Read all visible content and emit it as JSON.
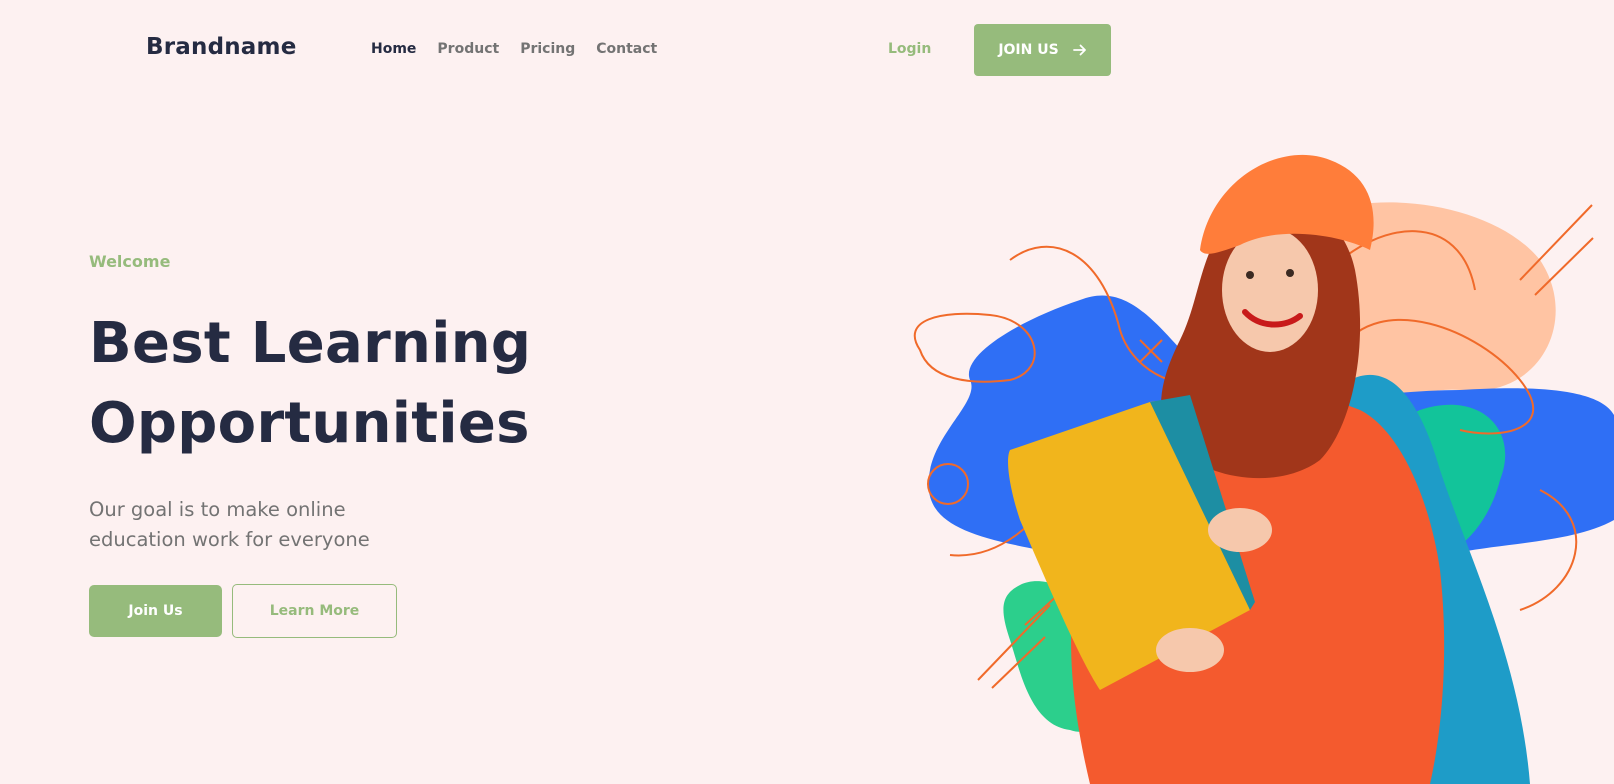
{
  "header": {
    "brand": "Brandname",
    "nav": [
      {
        "label": "Home",
        "active": true
      },
      {
        "label": "Product",
        "active": false
      },
      {
        "label": "Pricing",
        "active": false
      },
      {
        "label": "Contact",
        "active": false
      }
    ],
    "login_label": "Login",
    "join_label": "JOIN US",
    "join_icon": "arrow-right-icon"
  },
  "hero": {
    "eyebrow": "Welcome",
    "title_line1": "Best Learning",
    "title_line2": "Opportunities",
    "subtitle_line1": "Our goal is to make online",
    "subtitle_line2": "education work for everyone",
    "primary_button": "Join Us",
    "secondary_button": "Learn More"
  },
  "colors": {
    "background": "#fdf1f1",
    "accent_green": "#96bb7c",
    "heading": "#252b42",
    "muted_text": "#737373",
    "blob_blue": "#2f6ff5",
    "blob_peach": "#ffc4a3",
    "blob_green": "#12c49a",
    "line_orange": "#f06a2a"
  }
}
